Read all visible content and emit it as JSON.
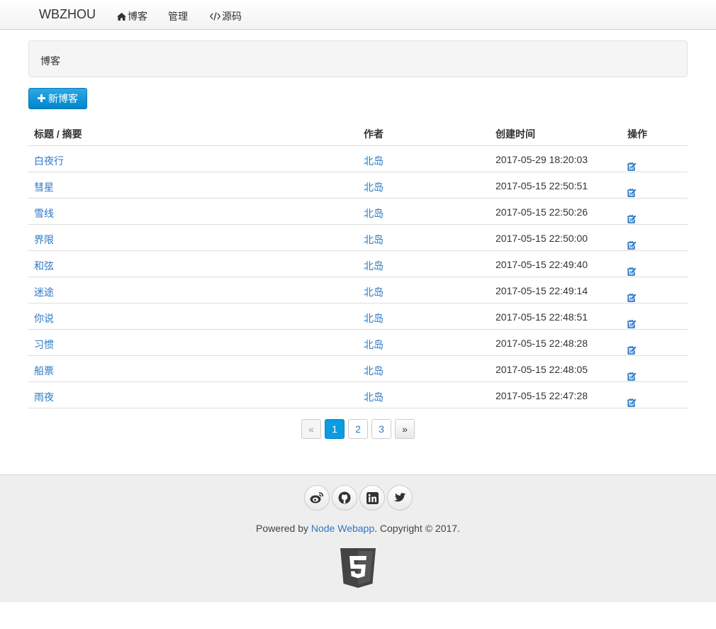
{
  "navbar": {
    "brand": "WBZHOU",
    "items": [
      {
        "label": "博客",
        "icon": "home-icon"
      },
      {
        "label": "管理"
      },
      {
        "label": "源码",
        "icon": "code-icon"
      }
    ]
  },
  "panel": {
    "title": "博客"
  },
  "toolbar": {
    "new_label": "新博客"
  },
  "table": {
    "headers": [
      "标题 / 摘要",
      "作者",
      "创建时间",
      "操作"
    ],
    "rows": [
      {
        "title": "白夜行",
        "author": "北岛",
        "created": "2017-05-29 18:20:03"
      },
      {
        "title": "彗星",
        "author": "北岛",
        "created": "2017-05-15 22:50:51"
      },
      {
        "title": "雪线",
        "author": "北岛",
        "created": "2017-05-15 22:50:26"
      },
      {
        "title": "界限",
        "author": "北岛",
        "created": "2017-05-15 22:50:00"
      },
      {
        "title": "和弦",
        "author": "北岛",
        "created": "2017-05-15 22:49:40"
      },
      {
        "title": "迷途",
        "author": "北岛",
        "created": "2017-05-15 22:49:14"
      },
      {
        "title": "你说",
        "author": "北岛",
        "created": "2017-05-15 22:48:51"
      },
      {
        "title": "习惯",
        "author": "北岛",
        "created": "2017-05-15 22:48:28"
      },
      {
        "title": "船票",
        "author": "北岛",
        "created": "2017-05-15 22:48:05"
      },
      {
        "title": "雨夜",
        "author": "北岛",
        "created": "2017-05-15 22:47:28"
      }
    ]
  },
  "pagination": {
    "prev": "«",
    "pages": [
      "1",
      "2",
      "3"
    ],
    "active": "1",
    "next": "»"
  },
  "footer": {
    "social_icons": [
      "weibo-icon",
      "github-icon",
      "linkedin-icon",
      "twitter-icon"
    ],
    "powered_prefix": "Powered by ",
    "powered_link": "Node Webapp",
    "powered_suffix": ". Copyright © 2017.",
    "badge_icon": "html5-icon"
  },
  "colors": {
    "link": "#2d79c4",
    "primary": "#0a9be0",
    "footer_bg": "#eeeeee"
  }
}
